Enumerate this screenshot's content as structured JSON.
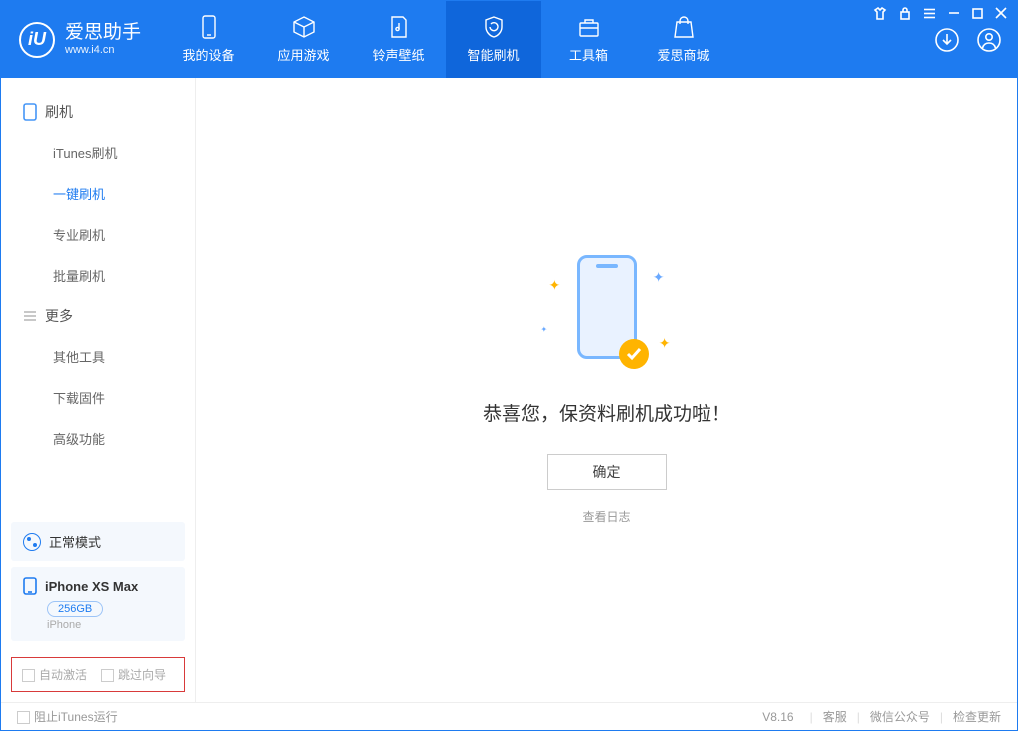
{
  "app": {
    "name_cn": "爱思助手",
    "name_en": "www.i4.cn",
    "logo_letter": "iU"
  },
  "nav": {
    "items": [
      {
        "label": "我的设备"
      },
      {
        "label": "应用游戏"
      },
      {
        "label": "铃声壁纸"
      },
      {
        "label": "智能刷机"
      },
      {
        "label": "工具箱"
      },
      {
        "label": "爱思商城"
      }
    ]
  },
  "sidebar": {
    "group1": {
      "title": "刷机",
      "items": [
        {
          "label": "iTunes刷机"
        },
        {
          "label": "一键刷机"
        },
        {
          "label": "专业刷机"
        },
        {
          "label": "批量刷机"
        }
      ]
    },
    "group2": {
      "title": "更多",
      "items": [
        {
          "label": "其他工具"
        },
        {
          "label": "下载固件"
        },
        {
          "label": "高级功能"
        }
      ]
    },
    "mode": {
      "label": "正常模式"
    },
    "device": {
      "name": "iPhone XS Max",
      "capacity": "256GB",
      "type": "iPhone"
    },
    "options": {
      "opt1": "自动激活",
      "opt2": "跳过向导"
    }
  },
  "main": {
    "success_text": "恭喜您，保资料刷机成功啦！",
    "ok_label": "确定",
    "log_link": "查看日志"
  },
  "status": {
    "block_itunes": "阻止iTunes运行",
    "version": "V8.16",
    "links": [
      "客服",
      "微信公众号",
      "检查更新"
    ]
  }
}
